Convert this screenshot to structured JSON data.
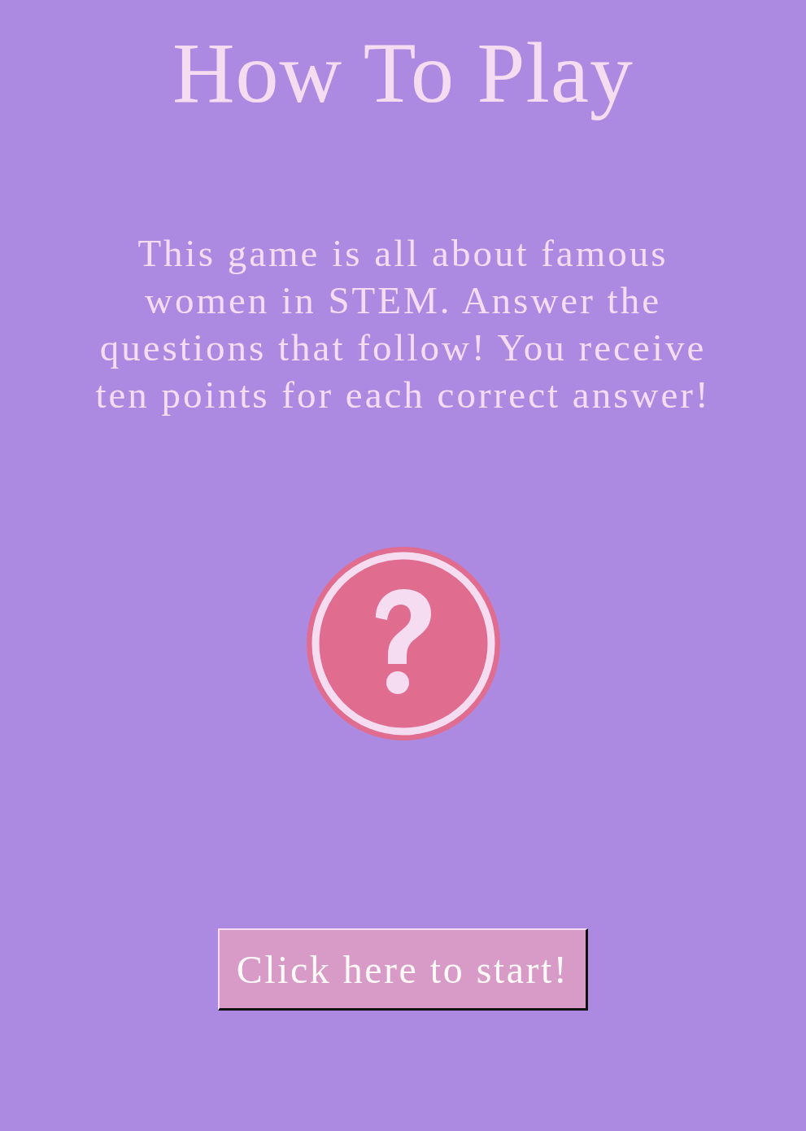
{
  "title": "How To Play",
  "instructions": "This game is all about famous women in STEM. Answer the questions that follow! You receive ten points for each correct answer!",
  "start_button": {
    "label": "Click here to start!"
  }
}
